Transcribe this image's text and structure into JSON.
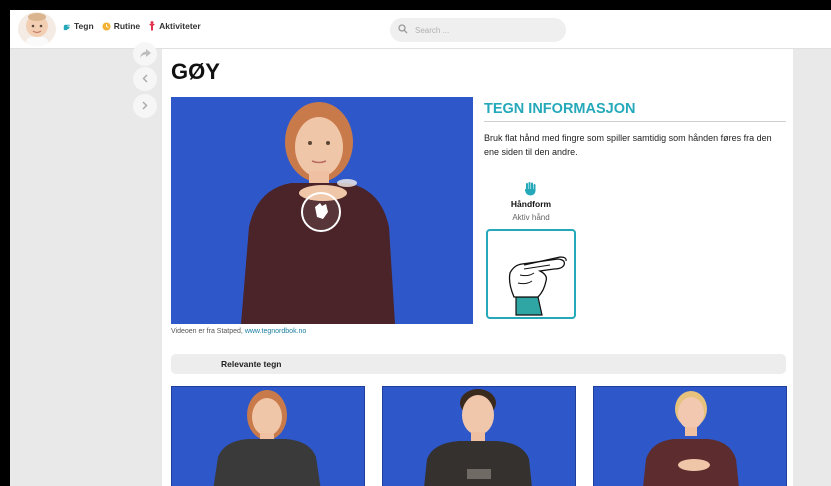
{
  "header": {
    "nav": [
      {
        "label": "Tegn",
        "icon": "hand-icon",
        "color": "#25a9ba"
      },
      {
        "label": "Rutine",
        "icon": "clock-icon",
        "color": "#f2b233"
      },
      {
        "label": "Aktiviteter",
        "icon": "figure-icon",
        "color": "#e0334d"
      }
    ],
    "search_placeholder": "Search ..."
  },
  "sign": {
    "title": "GØY",
    "caption_prefix": "Videoen er fra Statped, ",
    "caption_link": "www.tegnordbok.no"
  },
  "info": {
    "heading": "TEGN INFORMASJON",
    "description": "Bruk flat hånd med fingre som spiller samtidig som hånden føres fra den ene siden til den andre.",
    "handform_label": "Håndform",
    "handform_sub": "Aktiv hånd"
  },
  "related": {
    "label": "Relevante tegn"
  },
  "colors": {
    "accent": "#25a9ba",
    "video_bg": "#2e58c9"
  }
}
